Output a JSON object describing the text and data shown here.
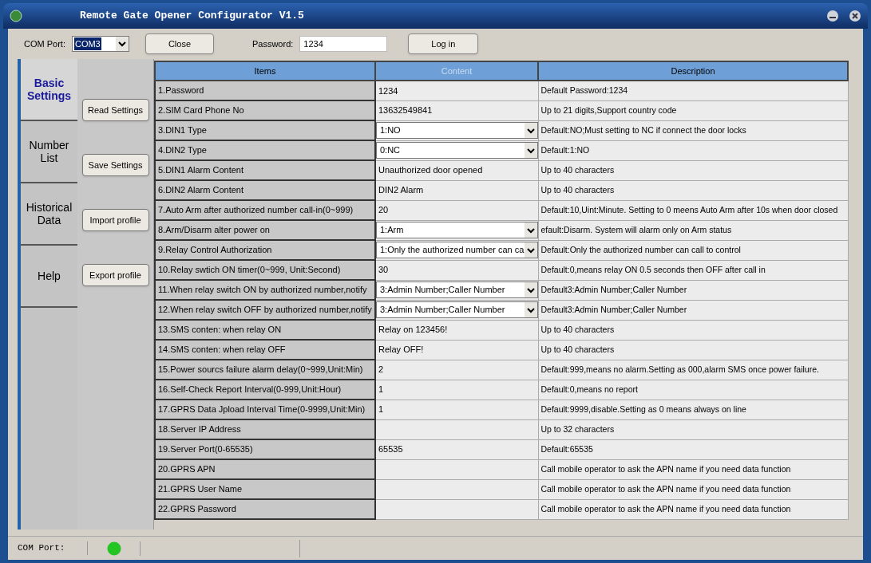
{
  "window": {
    "title": "Remote Gate Opener Configurator V1.5"
  },
  "toolbar": {
    "com_port_label": "COM Port:",
    "com_port_value": "COM3",
    "close_button": "Close",
    "password_label": "Password:",
    "password_value": "1234",
    "login_button": "Log in"
  },
  "tabs": [
    {
      "label": "Basic Settings",
      "selected": true
    },
    {
      "label": "Number List",
      "selected": false
    },
    {
      "label": "Historical Data",
      "selected": false
    },
    {
      "label": "Help",
      "selected": false
    }
  ],
  "actions": [
    "Read Settings",
    "Save Settings",
    "Import profile",
    "Export profile"
  ],
  "table": {
    "columns": [
      {
        "label": "Items",
        "dimmed": false
      },
      {
        "label": "Content",
        "dimmed": true
      },
      {
        "label": "Description",
        "dimmed": false
      }
    ],
    "rows": [
      {
        "item": "1.Password",
        "kind": "text",
        "content": "1234",
        "description": "Default Password:1234"
      },
      {
        "item": "2.SIM Card Phone No",
        "kind": "text",
        "content": "13632549841",
        "description": "Up to 21 digits,Support country code"
      },
      {
        "item": "3.DIN1 Type",
        "kind": "dropdown",
        "content": "1:NO",
        "description": "Default:NO;Must setting to NC if connect the door locks"
      },
      {
        "item": "4.DIN2 Type",
        "kind": "dropdown",
        "content": "0:NC",
        "description": "Default:1:NO"
      },
      {
        "item": "5.DIN1 Alarm Content",
        "kind": "text",
        "content": "Unauthorized door opened",
        "description": "Up to 40 characters"
      },
      {
        "item": "6.DIN2 Alarm Content",
        "kind": "text",
        "content": "DIN2 Alarm",
        "description": "Up to 40 characters"
      },
      {
        "item": "7.Auto Arm after authorized number call-in(0~999)",
        "kind": "text",
        "content": "20",
        "description": "Default:10,Uint:Minute. Setting to 0 meens Auto Arm after 10s when door closed"
      },
      {
        "item": "8.Arm/Disarm alter power on",
        "kind": "dropdown",
        "content": "1:Arm",
        "description": "efault:Disarm. System will alarm only on Arm status"
      },
      {
        "item": "9.Relay Control Authorization",
        "kind": "dropdown",
        "content": "1:Only the authorized number can ca",
        "description": "Default:Only the authorized number can call to control"
      },
      {
        "item": "10.Relay swtich ON timer(0~999, Unit:Second)",
        "kind": "text",
        "content": "30",
        "description": "Default:0,means relay ON 0.5 seconds then OFF after call in"
      },
      {
        "item": "11.When relay switch ON by authorized number,notify",
        "kind": "dropdown",
        "content": "3:Admin Number;Caller Number",
        "description": "Default3:Admin Number;Caller Number"
      },
      {
        "item": "12.When relay switch OFF by authorized number,notify",
        "kind": "dropdown",
        "content": "3:Admin Number;Caller Number",
        "description": "Default3:Admin Number;Caller Number"
      },
      {
        "item": "13.SMS conten: when relay ON",
        "kind": "text",
        "content": "Relay on 123456!",
        "description": "Up to 40 characters"
      },
      {
        "item": "14.SMS conten: when relay OFF",
        "kind": "text",
        "content": "Relay OFF!",
        "description": "Up to 40 characters"
      },
      {
        "item": "15.Power sourcs failure alarm delay(0~999,Unit:Min)",
        "kind": "text",
        "content": "2",
        "description": "Default:999,means no alarm.Setting as 000,alarm SMS once power failure."
      },
      {
        "item": "16.Self-Check Report Interval(0-999,Unit:Hour)",
        "kind": "text",
        "content": "1",
        "description": "Default:0,means no report"
      },
      {
        "item": "17.GPRS Data Jpload Interval Time(0-9999,Unit:Min)",
        "kind": "text",
        "content": "1",
        "description": "Default:9999,disable.Setting as 0 means always on line"
      },
      {
        "item": "18.Server IP Address",
        "kind": "text",
        "description": "Up to 32 characters"
      },
      {
        "item": "19.Server Port(0-65535)",
        "kind": "text",
        "content": "65535",
        "description": "Default:65535"
      },
      {
        "item": "20.GPRS APN",
        "kind": "text",
        "description": "Call mobile operator to ask the APN name if you need data function"
      },
      {
        "item": "21.GPRS User Name",
        "kind": "text",
        "description": "Call mobile operator to ask the APN name if you need data function"
      },
      {
        "item": "22.GPRS Password",
        "kind": "text",
        "description": "Call mobile operator to ask the APN name if you need data function"
      }
    ]
  },
  "status_bar": {
    "label": "COM Port:"
  }
}
